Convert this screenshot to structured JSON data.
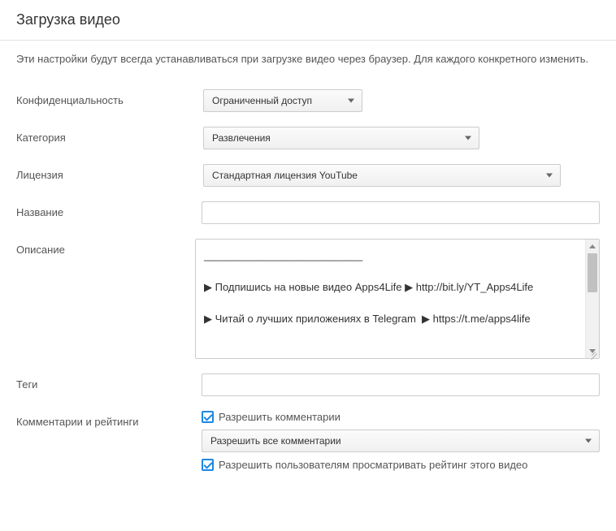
{
  "header": {
    "title": "Загрузка видео"
  },
  "intro": {
    "text": "Эти настройки будут всегда устанавливаться при загрузке видео через браузер. Для каждого конкретного изменить."
  },
  "form": {
    "privacy": {
      "label": "Конфиденциальность",
      "value": "Ограниченный доступ"
    },
    "category": {
      "label": "Категория",
      "value": "Развлечения"
    },
    "license": {
      "label": "Лицензия",
      "value": "Стандартная лицензия YouTube"
    },
    "title_field": {
      "label": "Название",
      "value": ""
    },
    "description": {
      "label": "Описание",
      "value": "___________________________\n\n▶ Подпишись на новые видео Apps4Life ▶ http://bit.ly/YT_Apps4Life\n\n▶ Читай о лучших приложениях в Telegram  ▶ https://t.me/apps4life"
    },
    "tags": {
      "label": "Теги",
      "value": ""
    },
    "comments_ratings": {
      "label": "Комментарии и рейтинги",
      "allow_comments_label": "Разрешить комментарии",
      "allow_comments_checked": true,
      "comments_policy": "Разрешить все комментарии",
      "allow_ratings_label": "Разрешить пользователям просматривать рейтинг этого видео",
      "allow_ratings_checked": true
    }
  }
}
